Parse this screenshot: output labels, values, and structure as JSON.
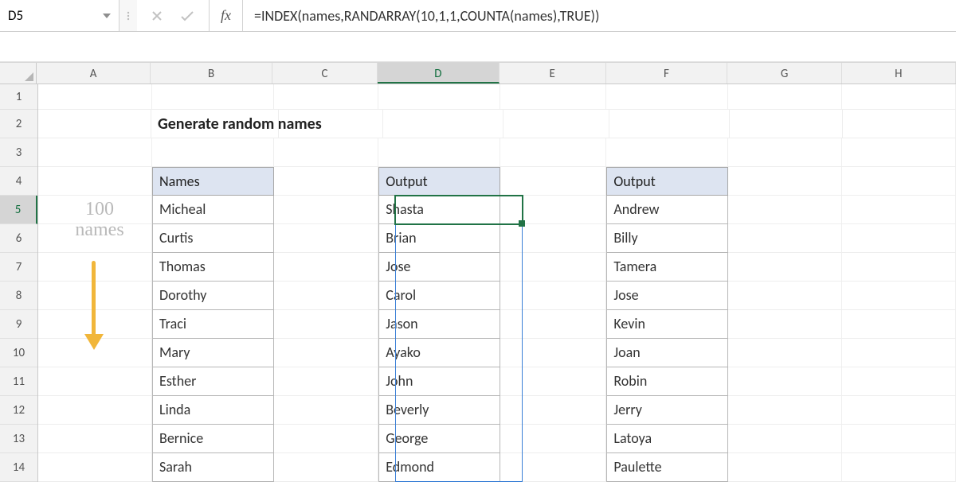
{
  "formula_bar": {
    "cell_reference": "D5",
    "fx_label": "fx",
    "formula": "=INDEX(names,RANDARRAY(10,1,1,COUNTA(names),TRUE))"
  },
  "columns": [
    "A",
    "B",
    "C",
    "D",
    "E",
    "F",
    "G",
    "H"
  ],
  "active_column": "D",
  "rows": [
    "1",
    "2",
    "3",
    "4",
    "5",
    "6",
    "7",
    "8",
    "9",
    "10",
    "11",
    "12",
    "13",
    "14"
  ],
  "active_row": "5",
  "sheet": {
    "title": "Generate random names",
    "annotation_line1": "100",
    "annotation_line2": "names",
    "columns": {
      "names": {
        "header": "Names",
        "values": [
          "Micheal",
          "Curtis",
          "Thomas",
          "Dorothy",
          "Traci",
          "Mary",
          "Esther",
          "Linda",
          "Bernice",
          "Sarah"
        ]
      },
      "output1": {
        "header": "Output",
        "values": [
          "Shasta",
          "Brian",
          "Jose",
          "Carol",
          "Jason",
          "Ayako",
          "John",
          "Beverly",
          "George",
          "Edmond"
        ]
      },
      "output2": {
        "header": "Output",
        "values": [
          "Andrew",
          "Billy",
          "Tamera",
          "Jose",
          "Kevin",
          "Joan",
          "Robin",
          "Jerry",
          "Latoya",
          "Paulette"
        ]
      }
    }
  },
  "colors": {
    "excel_green": "#217346",
    "header_fill": "#dde4f1",
    "arrow": "#f1b63a",
    "spill_blue": "#3a7fd6"
  }
}
